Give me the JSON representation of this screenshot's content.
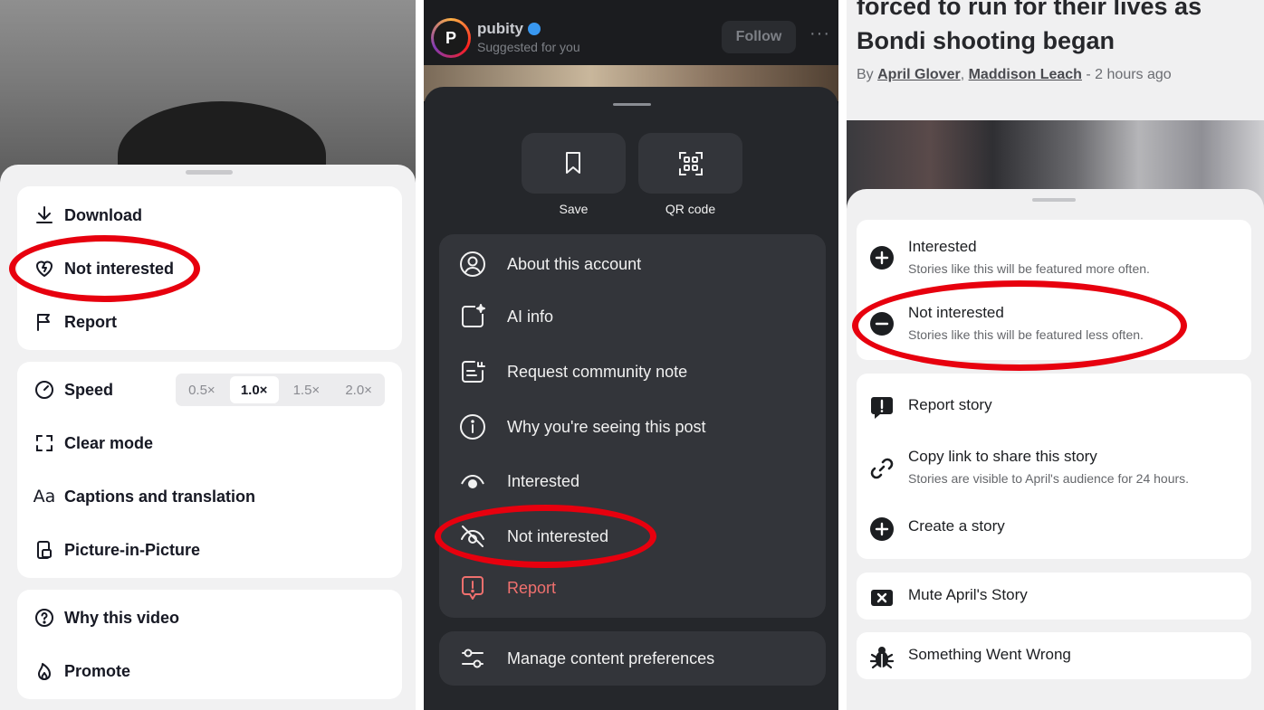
{
  "panel_tiktok": {
    "menu_items": {
      "download": "Download",
      "not_interested": "Not interested",
      "report": "Report",
      "speed": "Speed",
      "clear_mode": "Clear mode",
      "captions": "Captions and translation",
      "pip": "Picture-in-Picture",
      "why_video": "Why this video",
      "promote": "Promote"
    },
    "speed_options": [
      "0.5×",
      "1.0×",
      "1.5×",
      "2.0×"
    ],
    "speed_selected": "1.0×"
  },
  "panel_instagram": {
    "account_name": "pubity",
    "account_subtitle": "Suggested for you",
    "follow_label": "Follow",
    "more_label": "···",
    "quick_actions": {
      "save": "Save",
      "qr": "QR code"
    },
    "menu_items": {
      "about": "About this account",
      "ai_info": "AI info",
      "community_note": "Request community note",
      "why_seeing": "Why you're seeing this post",
      "interested": "Interested",
      "not_interested": "Not interested",
      "report": "Report"
    },
    "manage_prefs": "Manage content preferences"
  },
  "panel_facebook": {
    "headline": "forced to run for their lives as Bondi shooting began",
    "byline": {
      "prefix": "By ",
      "author1": "April Glover",
      "sep": ", ",
      "author2": "Maddison Leach",
      "suffix": " - 2 hours ago"
    },
    "menu_items": {
      "interested": "Interested",
      "interested_sub": "Stories like this will be featured more often.",
      "not_interested": "Not interested",
      "not_interested_sub": "Stories like this will be featured less often.",
      "report": "Report story",
      "copy_link": "Copy link to share this story",
      "copy_link_sub": "Stories are visible to April's audience for 24 hours.",
      "create": "Create a story",
      "mute": "Mute April's Story",
      "wrong": "Something Went Wrong"
    }
  },
  "colors": {
    "annotation_red": "#e7000e",
    "report_red": "#f0706e"
  }
}
